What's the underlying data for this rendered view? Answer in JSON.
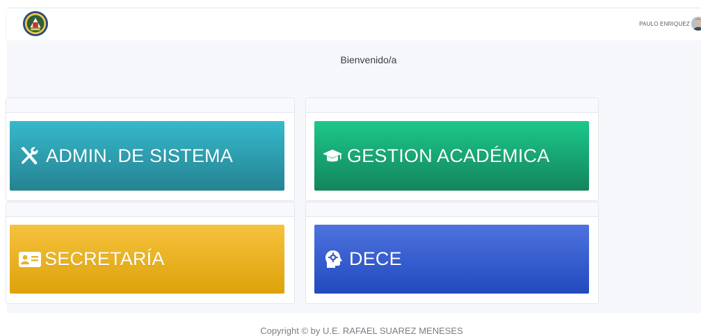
{
  "header": {
    "user_name": "PAULO ENRIQUEZ"
  },
  "main": {
    "welcome": "Bienvenido/a",
    "tiles": [
      {
        "label": "ADMIN. DE SISTEMA",
        "icon": "tools-icon",
        "color": "#36b9cc"
      },
      {
        "label": "GESTION ACADÉMICA",
        "icon": "graduation-cap-icon",
        "color": "#1cc88a"
      },
      {
        "label": "SECRETARÍA",
        "icon": "id-card-icon",
        "color": "#f6c23e"
      },
      {
        "label": "DECE",
        "icon": "brain-head-icon",
        "color": "#4e73df"
      }
    ]
  },
  "footer": {
    "copyright": "Copyright © by U.E. RAFAEL SUAREZ MENESES"
  }
}
